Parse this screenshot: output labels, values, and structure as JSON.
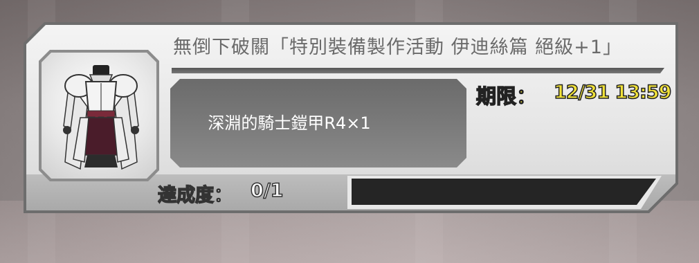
{
  "mission": {
    "title": "無倒下破關「特別裝備製作活動 伊迪絲篇 絕級+1」",
    "reward": "深淵的騎士鎧甲R4×1",
    "deadline_label": "期限：",
    "deadline_value": "12/31 13:59",
    "progress_label": "達成度：",
    "progress_value": "0/1",
    "progress_fraction": 0,
    "reward_icon": "knight-armor-icon"
  },
  "colors": {
    "accent_yellow": "#f1e23a",
    "bar_track": "#252525",
    "reward_box": "#757575"
  }
}
